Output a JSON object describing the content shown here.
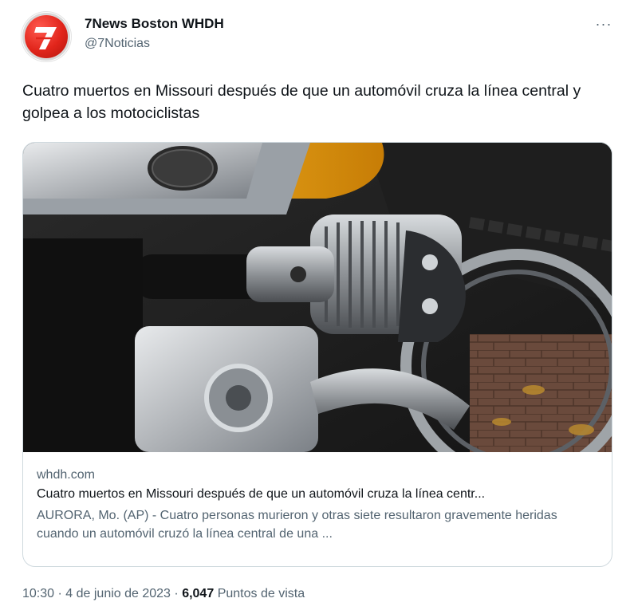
{
  "author": {
    "name": "7News Boston WHDH",
    "handle": "@7Noticias",
    "avatar_icon": "7news-logo-icon",
    "brand_color": "#e1251b"
  },
  "menu": {
    "more_icon": "more-options-icon",
    "label": "···"
  },
  "tweet": {
    "text": "Cuatro muertos en Missouri después de que un automóvil cruza la línea central y golpea a los motociclistas"
  },
  "link_card": {
    "image_subject": "motorcycle-engine-photo",
    "domain": "whdh.com",
    "title": "Cuatro muertos en Missouri después de que un automóvil cruza la línea centr...",
    "description": "AURORA, Mo. (AP) - Cuatro personas murieron y otras siete resultaron gravemente heridas cuando un automóvil cruzó la línea central de una ..."
  },
  "footer": {
    "time": "10:30",
    "date": "4 de junio de 2023",
    "separator": "·",
    "views_count": "6,047",
    "views_label": "Puntos de vista"
  }
}
